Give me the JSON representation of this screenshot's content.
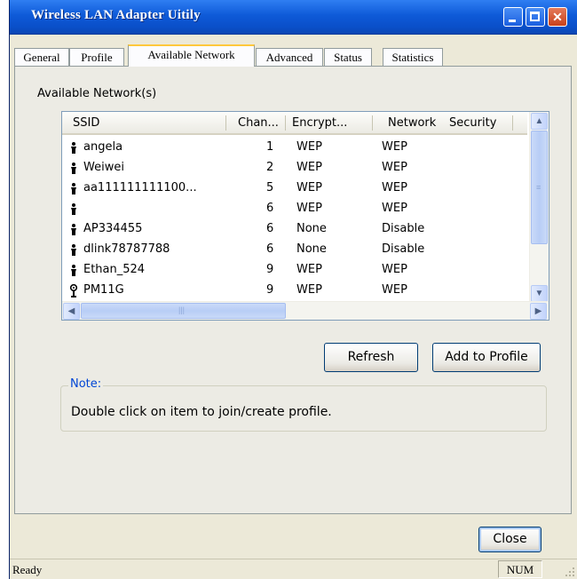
{
  "window": {
    "title": "Wireless LAN Adapter Uitily"
  },
  "tabs": [
    {
      "label": "General"
    },
    {
      "label": "Profile"
    },
    {
      "label": "Available Network",
      "active": true
    },
    {
      "label": "Advanced"
    },
    {
      "label": "Status"
    },
    {
      "label": "Statistics"
    }
  ],
  "section_label": "Available Network(s)",
  "network_list": {
    "columns": [
      "SSID",
      "Chan...",
      "Encrypt...",
      "Network",
      "Security"
    ],
    "rows": [
      {
        "icon": "person-icon",
        "ssid": "angela",
        "channel": "1",
        "encryption": "WEP",
        "network": "WEP"
      },
      {
        "icon": "person-icon",
        "ssid": "Weiwei",
        "channel": "2",
        "encryption": "WEP",
        "network": "WEP"
      },
      {
        "icon": "person-icon",
        "ssid": "aa111111111100...",
        "channel": "5",
        "encryption": "WEP",
        "network": "WEP"
      },
      {
        "icon": "person-icon",
        "ssid": "",
        "channel": "6",
        "encryption": "WEP",
        "network": "WEP"
      },
      {
        "icon": "person-icon",
        "ssid": "AP334455",
        "channel": "6",
        "encryption": "None",
        "network": "Disable"
      },
      {
        "icon": "person-icon",
        "ssid": "dlink78787788",
        "channel": "6",
        "encryption": "None",
        "network": "Disable"
      },
      {
        "icon": "person-icon",
        "ssid": "Ethan_524",
        "channel": "9",
        "encryption": "WEP",
        "network": "WEP"
      },
      {
        "icon": "access-point-icon",
        "ssid": "PM11G",
        "channel": "9",
        "encryption": "WEP",
        "network": "WEP"
      }
    ]
  },
  "buttons": {
    "refresh": "Refresh",
    "add_to_profile": "Add to Profile",
    "close": "Close"
  },
  "note": {
    "title": "Note:",
    "text": "Double click on item to join/create profile."
  },
  "status_bar": {
    "text": "Ready",
    "num": "NUM"
  },
  "colors": {
    "title_bar": "#0a4fc9",
    "note_title": "#0046d5",
    "window_bg": "#ece9d8"
  }
}
